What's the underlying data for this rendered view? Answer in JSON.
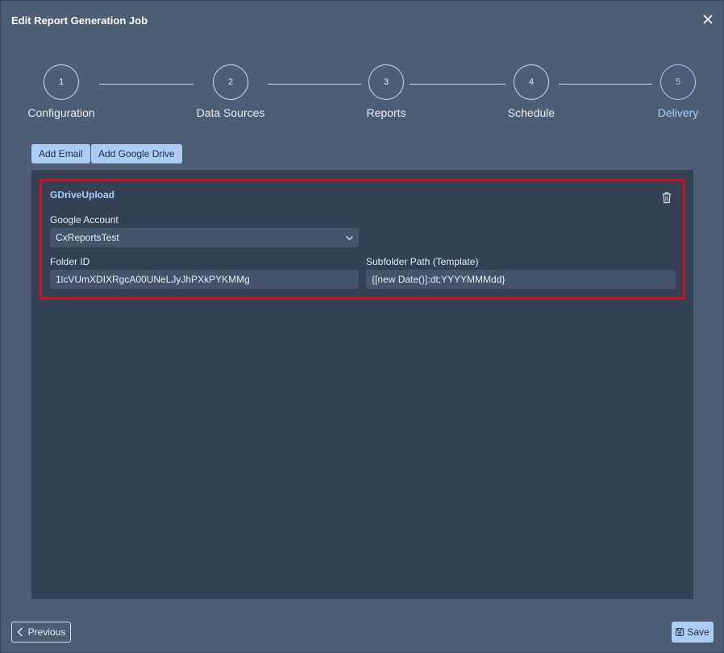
{
  "dialog": {
    "title": "Edit Report Generation Job"
  },
  "steps": [
    {
      "number": "1",
      "label": "Configuration"
    },
    {
      "number": "2",
      "label": "Data Sources"
    },
    {
      "number": "3",
      "label": "Reports"
    },
    {
      "number": "4",
      "label": "Schedule"
    },
    {
      "number": "5",
      "label": "Delivery",
      "active": true
    }
  ],
  "toolbar": {
    "add_email": "Add Email",
    "add_google_drive": "Add Google Drive"
  },
  "delivery_card": {
    "title": "GDriveUpload",
    "google_account_label": "Google Account",
    "google_account_value": "CxReportsTest",
    "folder_id_label": "Folder ID",
    "folder_id_value": "1lcVUmXDIXRgcA00UNeLJyJhPXkPYKMMg",
    "subfolder_label": "Subfolder Path (Template)",
    "subfolder_value": "{[new Date()]:dt;YYYYMMMdd}"
  },
  "footer": {
    "previous": "Previous",
    "save": "Save"
  },
  "colors": {
    "accent": "#a9cdf7",
    "highlight_border": "#d0111b",
    "background": "#4d5d72",
    "panel": "#334152"
  },
  "icons": {
    "close": "close-icon",
    "trash": "trash-icon",
    "chevron": "chevron-down-icon",
    "previous": "chevron-left-icon",
    "save": "save-icon"
  }
}
